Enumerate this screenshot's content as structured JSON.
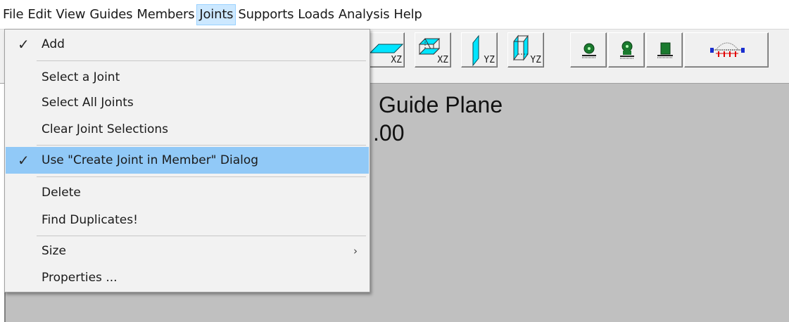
{
  "menubar": {
    "items": [
      "File",
      "Edit",
      "View",
      "Guides",
      "Members",
      "Joints",
      "Supports",
      "Loads",
      "Analysis",
      "Help"
    ],
    "active": "Joints"
  },
  "toolbar": {
    "buttons": [
      {
        "icon": "xz-plane-icon",
        "sub": "XZ"
      },
      {
        "icon": "xz-box-icon",
        "sub": "XZ"
      },
      {
        "icon": "yz-plane-icon",
        "sub": "YZ"
      },
      {
        "icon": "yz-box-icon",
        "sub": "YZ"
      },
      {
        "icon": "pin-support-icon",
        "sub": ""
      },
      {
        "icon": "roller-support-icon",
        "sub": ""
      },
      {
        "icon": "fixed-support-icon",
        "sub": ""
      },
      {
        "icon": "distributed-load-icon",
        "sub": ""
      }
    ],
    "colors": {
      "cyan": "#00e5ff",
      "green": "#1a7a2e",
      "red": "#e00000",
      "blue": "#1a2fd0"
    }
  },
  "canvas": {
    "line1": "Guide Plane",
    "line2": ".00"
  },
  "dropdown": {
    "items": [
      {
        "label": "Add",
        "checked": true
      },
      {
        "label": "Select a Joint",
        "checked": false
      },
      {
        "label": "Select All Joints",
        "checked": false
      },
      {
        "label": "Clear Joint Selections",
        "checked": false
      },
      {
        "label": "Use \"Create Joint in Member\" Dialog",
        "checked": true,
        "highlighted": true
      },
      {
        "label": "Delete",
        "checked": false
      },
      {
        "label": "Find Duplicates!",
        "checked": false
      },
      {
        "label": "Size",
        "submenu": true
      },
      {
        "label": "Properties ...",
        "checked": false
      }
    ],
    "check_glyph": "✓",
    "submenu_glyph": "›"
  }
}
